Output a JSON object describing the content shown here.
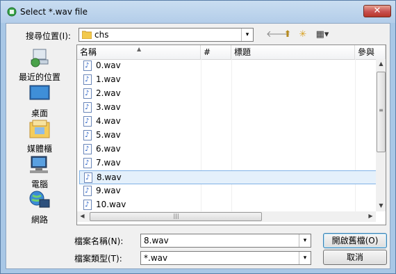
{
  "window": {
    "title": "Select *.wav file",
    "close_label": "✕"
  },
  "lookin": {
    "label": "搜尋位置(I):",
    "value": "chs",
    "arrow": "▾"
  },
  "toolbar": {
    "back_icon": "🡐",
    "up_icon": "⬆",
    "newfolder_icon": "✳",
    "views_icon": "▦▾"
  },
  "places": [
    {
      "label": "最近的位置",
      "icon": "recent-places-icon"
    },
    {
      "label": "桌面",
      "icon": "desktop-icon"
    },
    {
      "label": "媒體櫃",
      "icon": "libraries-icon"
    },
    {
      "label": "電腦",
      "icon": "computer-icon"
    },
    {
      "label": "網路",
      "icon": "network-icon"
    }
  ],
  "columns": {
    "name": "名稱",
    "number": "#",
    "title": "標題",
    "more": "參與"
  },
  "files": [
    "0.wav",
    "1.wav",
    "2.wav",
    "3.wav",
    "4.wav",
    "5.wav",
    "6.wav",
    "7.wav",
    "8.wav",
    "9.wav",
    "10.wav"
  ],
  "selected_index": 8,
  "filename": {
    "label": "檔案名稱(N):",
    "value": "8.wav"
  },
  "filetype": {
    "label": "檔案類型(T):",
    "value": "*.wav"
  },
  "buttons": {
    "open": "開啟舊檔(O)",
    "cancel": "取消"
  }
}
